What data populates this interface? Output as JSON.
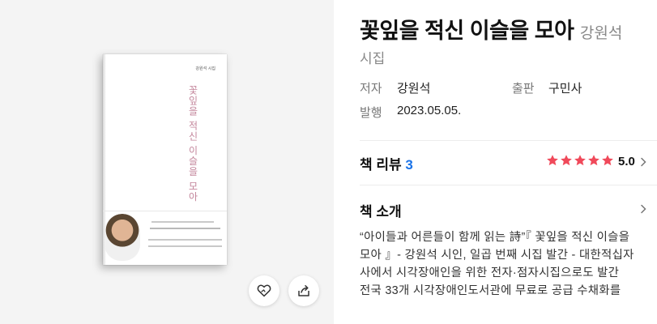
{
  "book": {
    "title": "꽃잎을 적신 이슬을 모아",
    "author": "강원석",
    "category": "시집",
    "cover": {
      "author_label": "강원석 시집",
      "title_vertical": "꽃잎을 적신 이슬을 모아"
    }
  },
  "meta": {
    "author_label": "저자",
    "author_value": "강원석",
    "publisher_label": "출판",
    "publisher_value": "구민사",
    "date_label": "발행",
    "date_value": "2023.05.05."
  },
  "review": {
    "title": "책 리뷰",
    "count": "3",
    "rating": "5.0",
    "stars": 5,
    "star_color": "#f0495a"
  },
  "intro": {
    "title": "책 소개",
    "lines": [
      "“아이들과 어른들이 함께 읽는 詩”『 꽃잎을 적신 이슬을",
      "모아 』- 강원석 시인, 일곱 번째 시집 발간 - 대한적십자",
      "사에서 시각장애인을 위한 전자·점자시집으로도 발간",
      "전국 33개 시각장애인도서관에 무료로 공급 수채화를 "
    ]
  },
  "actions": {
    "like_icon": "heart-icon",
    "share_icon": "share-icon"
  },
  "colors": {
    "left_bg": "#f4f4f4",
    "accent": "#1a73e8",
    "cover_title": "#c3859b"
  }
}
